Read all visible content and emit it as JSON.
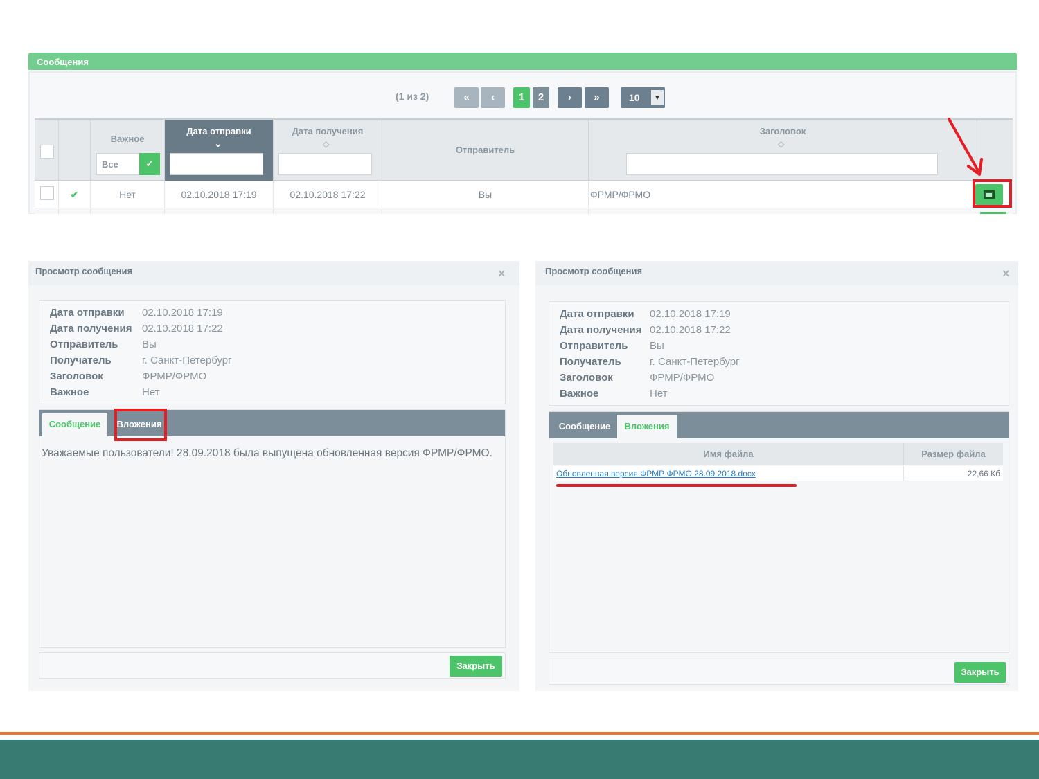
{
  "messages_panel": {
    "title": "Сообщения",
    "paginator": {
      "info": "(1 из 2)",
      "first_icon": "«",
      "prev_icon": "‹",
      "pages": [
        "1",
        "2"
      ],
      "next_icon": "›",
      "last_icon": "»",
      "rows_per_page": "10"
    },
    "columns": {
      "important": "Важное",
      "sent_date": "Дата отправки",
      "received_date": "Дата получения",
      "sender": "Отправитель",
      "subject": "Заголовок"
    },
    "important_filter_value": "Все",
    "row": {
      "read_icon": "✔",
      "important": "Нет",
      "sent_date": "02.10.2018 17:19",
      "received_date": "02.10.2018 17:22",
      "sender": "Вы",
      "subject": "ФРМР/ФРМО"
    }
  },
  "dialog_left": {
    "title": "Просмотр сообщения",
    "close_icon": "×",
    "fields": [
      {
        "label": "Дата отправки",
        "value": "02.10.2018 17:19"
      },
      {
        "label": "Дата получения",
        "value": "02.10.2018 17:22"
      },
      {
        "label": "Отправитель",
        "value": "Вы"
      },
      {
        "label": "Получатель",
        "value": "г. Санкт-Петербург"
      },
      {
        "label": "Заголовок",
        "value": "ФРМР/ФРМО"
      },
      {
        "label": "Важное",
        "value": "Нет"
      }
    ],
    "tabs": [
      "Сообщение",
      "Вложения"
    ],
    "message_text": "Уважаемые пользователи! 28.09.2018 была выпущена обновленная версия ФРМР/ФРМО.",
    "close_button": "Закрыть"
  },
  "dialog_right": {
    "title": "Просмотр сообщения",
    "close_icon": "×",
    "fields": [
      {
        "label": "Дата отправки",
        "value": "02.10.2018 17:19"
      },
      {
        "label": "Дата получения",
        "value": "02.10.2018 17:22"
      },
      {
        "label": "Отправитель",
        "value": "Вы"
      },
      {
        "label": "Получатель",
        "value": "г. Санкт-Петербург"
      },
      {
        "label": "Заголовок",
        "value": "ФРМР/ФРМО"
      },
      {
        "label": "Важное",
        "value": "Нет"
      }
    ],
    "tabs": [
      "Сообщение",
      "Вложения"
    ],
    "attachments": {
      "col_name": "Имя файла",
      "col_size": "Размер файла",
      "files": [
        {
          "name": "Обновленная версия ФРМР ФРМО 28.09.2018.docx",
          "size": "22,66 Кб"
        }
      ]
    },
    "close_button": "Закрыть"
  },
  "colors": {
    "accent_green": "#4dc46a",
    "header_green": "#72cd8e",
    "highlight_red": "#e31e24",
    "orange": "#e7762f",
    "teal": "#387b73"
  }
}
